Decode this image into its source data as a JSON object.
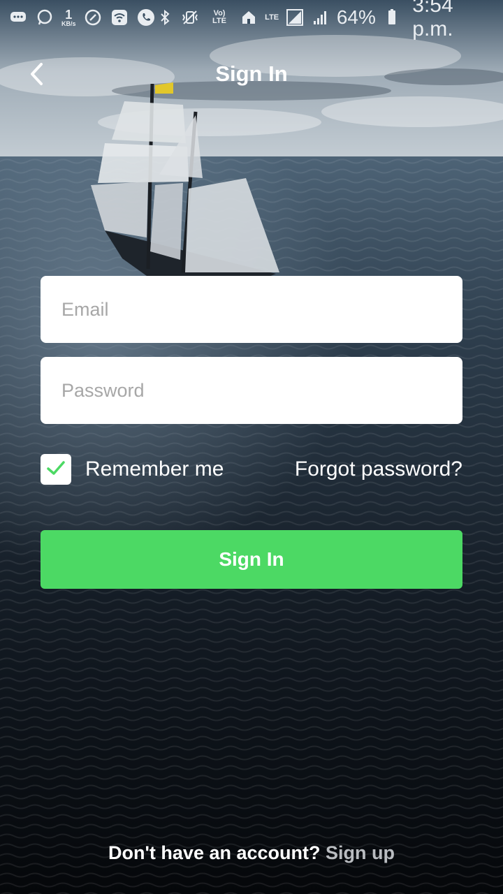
{
  "status_bar": {
    "speed_value": "1",
    "speed_unit": "KB/s",
    "volte_label": "Vo) LTE",
    "lte_label": "LTE",
    "battery_percent": "64%",
    "time": "3:54 p.m.",
    "icons": [
      "message-icon",
      "whatsapp-icon",
      "speed-indicator",
      "sync-icon",
      "wifi-icon",
      "phone-icon",
      "bluetooth-icon",
      "vibrate-icon",
      "volte-icon",
      "home-icon",
      "lte-icon",
      "signal-icon",
      "battery-icon"
    ]
  },
  "header": {
    "title": "Sign In",
    "back_icon": "chevron-left-icon"
  },
  "form": {
    "email_placeholder": "Email",
    "email_value": "",
    "password_placeholder": "Password",
    "password_value": "",
    "remember_label": "Remember me",
    "remember_checked": true,
    "forgot_label": "Forgot password?",
    "submit_label": "Sign In"
  },
  "footer": {
    "prompt": "Don't have an account?",
    "signup_label": "Sign up"
  },
  "colors": {
    "accent": "#4cd964",
    "link_muted": "#b9bcc0",
    "checkmark": "#4cd964"
  }
}
